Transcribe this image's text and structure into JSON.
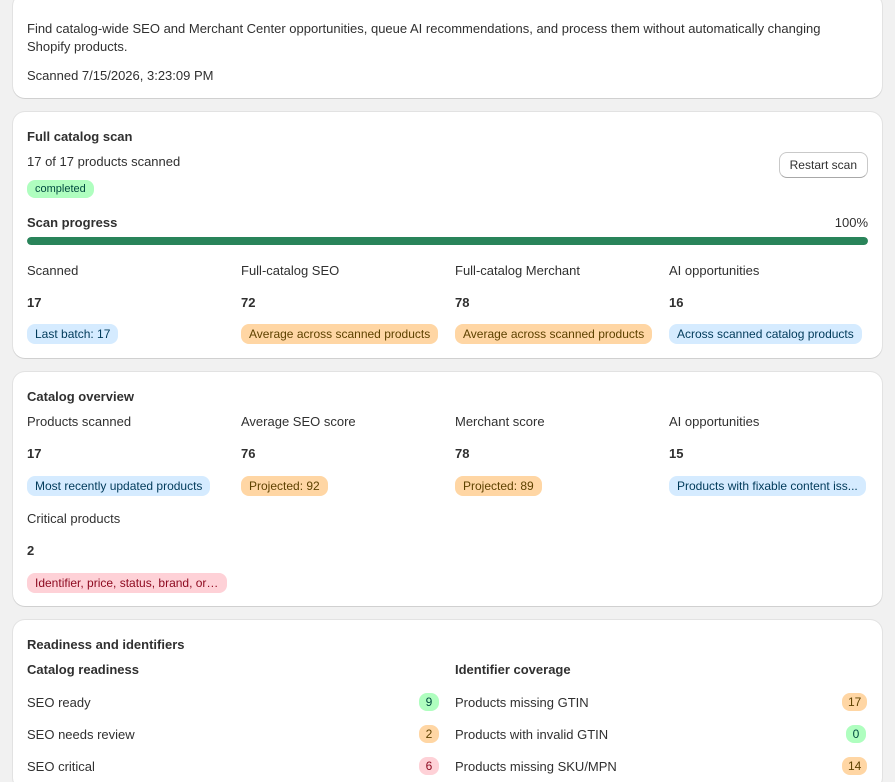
{
  "intro": {
    "description": "Find catalog-wide SEO and Merchant Center opportunities, queue AI recommendations, and process them without automatically changing Shopify products.",
    "scanned_at": "Scanned 7/15/2026, 3:23:09 PM"
  },
  "full_scan": {
    "title": "Full catalog scan",
    "progress_text": "17 of 17 products scanned",
    "status_badge": "completed",
    "restart_label": "Restart scan",
    "progress_label": "Scan progress",
    "progress_percent_label": "100%",
    "progress_fraction": 1.0,
    "stats": [
      {
        "label": "Scanned",
        "value": "17",
        "badge": "Last batch: 17",
        "tone": "blue"
      },
      {
        "label": "Full-catalog SEO",
        "value": "72",
        "badge": "Average across scanned products",
        "tone": "orange"
      },
      {
        "label": "Full-catalog Merchant",
        "value": "78",
        "badge": "Average across scanned products",
        "tone": "orange"
      },
      {
        "label": "AI opportunities",
        "value": "16",
        "badge": "Across scanned catalog products",
        "tone": "blue"
      }
    ]
  },
  "overview": {
    "title": "Catalog overview",
    "stats": [
      {
        "label": "Products scanned",
        "value": "17",
        "badge": "Most recently updated products",
        "tone": "blue"
      },
      {
        "label": "Average SEO score",
        "value": "76",
        "badge": "Projected: 92",
        "tone": "orange"
      },
      {
        "label": "Merchant score",
        "value": "78",
        "badge": "Projected: 89",
        "tone": "orange"
      },
      {
        "label": "AI opportunities",
        "value": "15",
        "badge": "Products with fixable content iss...",
        "tone": "blue"
      },
      {
        "label": "Critical products",
        "value": "2",
        "badge": "Identifier, price, status, brand, or ...",
        "tone": "red"
      }
    ]
  },
  "readiness": {
    "title": "Readiness and identifiers",
    "catalog_title": "Catalog readiness",
    "identifier_title": "Identifier coverage",
    "catalog_rows": [
      {
        "label": "SEO ready",
        "count": "9",
        "tone": "green"
      },
      {
        "label": "SEO needs review",
        "count": "2",
        "tone": "orange"
      },
      {
        "label": "SEO critical",
        "count": "6",
        "tone": "red"
      }
    ],
    "identifier_rows": [
      {
        "label": "Products missing GTIN",
        "count": "17",
        "tone": "orange"
      },
      {
        "label": "Products with invalid GTIN",
        "count": "0",
        "tone": "green"
      },
      {
        "label": "Products missing SKU/MPN",
        "count": "14",
        "tone": "orange"
      }
    ]
  }
}
